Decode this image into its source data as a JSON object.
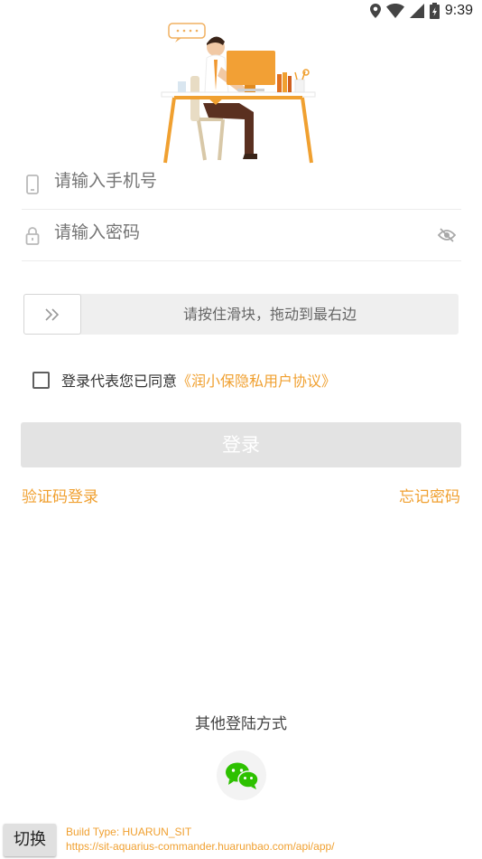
{
  "status_bar": {
    "time": "9:39",
    "icons": [
      "location-icon",
      "wifi-icon",
      "signal-icon",
      "battery-icon"
    ]
  },
  "form": {
    "phone_placeholder": "请输入手机号",
    "password_placeholder": "请输入密码",
    "slider_hint": "请按住滑块，拖动到最右边"
  },
  "agreement": {
    "checked": false,
    "text": "登录代表您已同意",
    "link": "《润小保隐私用户协议》"
  },
  "login_button": "登录",
  "links": {
    "sms_login": "验证码登录",
    "forgot_password": "忘记密码"
  },
  "other_login": {
    "title": "其他登陆方式",
    "methods": [
      "wechat-icon"
    ]
  },
  "debug": {
    "switch_label": "切换",
    "build_type": "Build Type:  HUARUN_SIT",
    "api_url": "https://sit-aquarius-commander.huarunbao.com/api/app/"
  },
  "colors": {
    "accent": "#f0a030",
    "disabled_button": "#e3e3e3",
    "wechat_green": "#2dc100"
  }
}
